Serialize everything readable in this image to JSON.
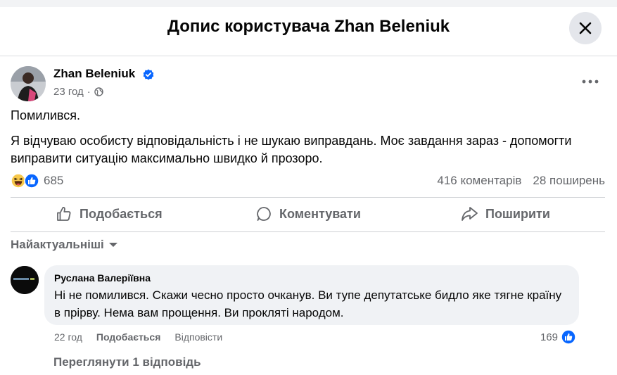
{
  "dialog": {
    "title": "Допис користувача Zhan Beleniuk"
  },
  "post": {
    "author": "Zhan Beleniuk",
    "time": "23 год",
    "line1": "Помилився.",
    "line2": "Я відчуваю особисту відповідальність і не шукаю виправдань. Моє завдання зараз - допомогти виправити ситуацію максимально швидко й прозоро.",
    "reactions_count": "685",
    "comments_count": "416 коментарів",
    "shares_count": "28 поширень"
  },
  "actions": {
    "like": "Подобається",
    "comment": "Коментувати",
    "share": "Поширити"
  },
  "sort": {
    "label": "Найактуальніші"
  },
  "comment": {
    "author": "Руслана Валеріївна",
    "text": "Ні не помилився. Скажи чесно просто очканув. Ви тупе депутатське бидло яке тягне країну в прірву. Нема вам прощення. Ви прокляті народом.",
    "time": "22 год",
    "like": "Подобається",
    "reply": "Відповісти",
    "reactions_count": "169"
  },
  "replies": {
    "label": "Переглянути 1 відповідь"
  },
  "colors": {
    "accent": "#0866ff",
    "muted": "#65676b",
    "bubble": "#f0f2f5"
  }
}
